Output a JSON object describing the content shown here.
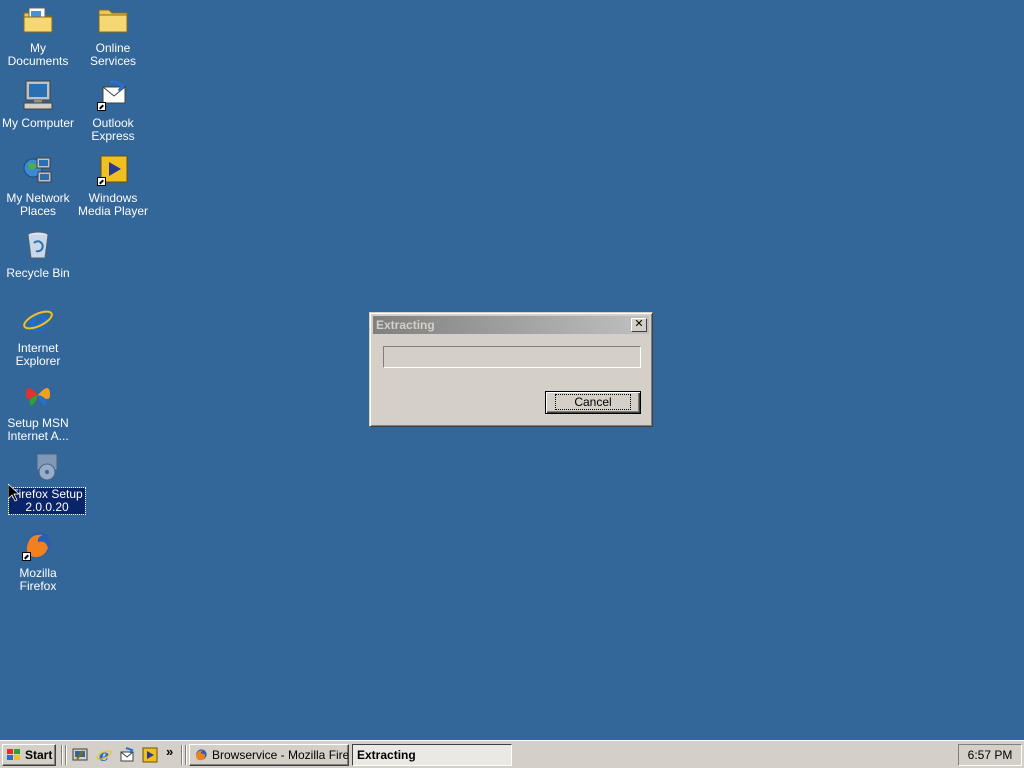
{
  "desktop": {
    "background_color": "#336699",
    "icons": [
      {
        "label": "My Documents",
        "icon": "my-documents-icon"
      },
      {
        "label": "Online Services",
        "icon": "folder-icon"
      },
      {
        "label": "My Computer",
        "icon": "my-computer-icon"
      },
      {
        "label": "Outlook Express",
        "icon": "outlook-express-icon"
      },
      {
        "label": "My Network Places",
        "icon": "network-places-icon"
      },
      {
        "label": "Windows Media Player",
        "icon": "media-player-icon"
      },
      {
        "label": "Recycle Bin",
        "icon": "recycle-bin-icon"
      },
      {
        "label": "Internet Explorer",
        "icon": "internet-explorer-icon"
      },
      {
        "label": "Setup MSN Internet A...",
        "icon": "msn-butterfly-icon"
      },
      {
        "label": "Firefox Setup 2.0.0.20",
        "icon": "installer-icon",
        "selected": true
      },
      {
        "label": "Mozilla Firefox",
        "icon": "firefox-icon"
      }
    ]
  },
  "dialog": {
    "title": "Extracting",
    "close_glyph": "✕",
    "progress_fraction": 0,
    "cancel_label": "Cancel"
  },
  "taskbar": {
    "start_label": "Start",
    "quick_launch": [
      "show-desktop-icon",
      "internet-explorer-icon",
      "outlook-express-icon",
      "media-player-icon"
    ],
    "chevron": "»",
    "tasks": [
      {
        "label": "Browservice - Mozilla Firefox",
        "icon": "firefox-icon",
        "active": false
      },
      {
        "label": "Extracting",
        "active": true
      }
    ],
    "clock": "6:57 PM"
  }
}
